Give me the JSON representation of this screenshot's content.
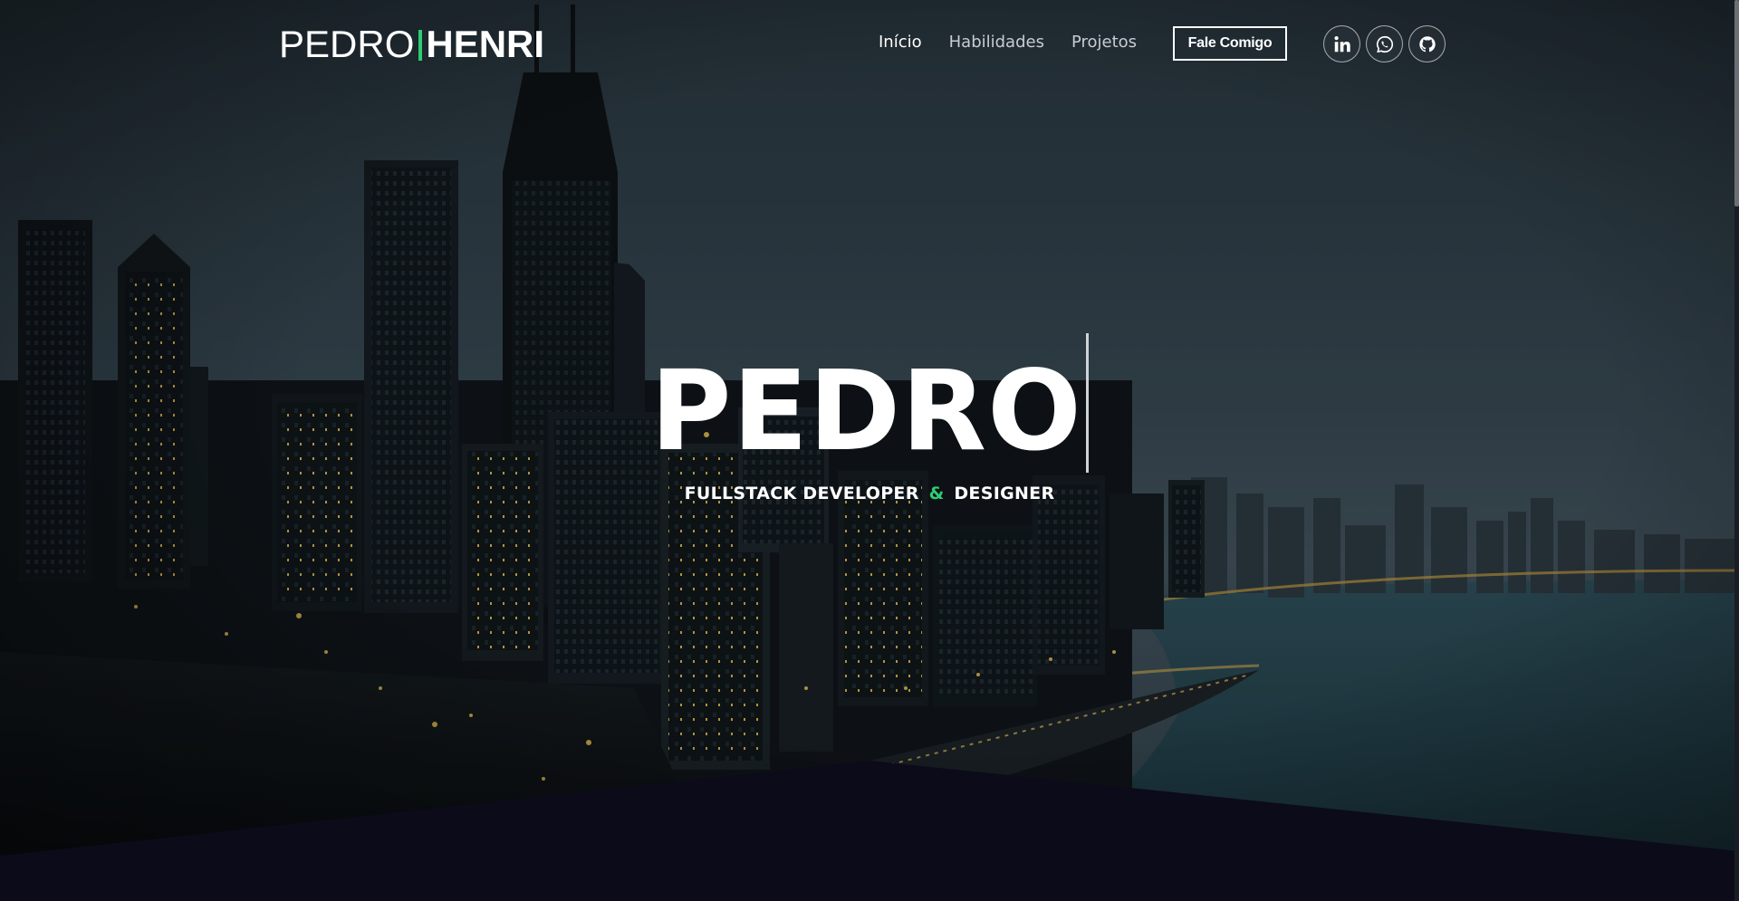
{
  "colors": {
    "accent": "#2ecc71",
    "sky_top": "#2b3b44",
    "sky_bottom": "#3a4a55",
    "water": "#1f3a45",
    "bottom_band": "#0c0b1a"
  },
  "header": {
    "logo_first": "PEDRO",
    "logo_second": "HENRI",
    "nav": [
      {
        "label": "Início",
        "active": true
      },
      {
        "label": "Habilidades",
        "active": false
      },
      {
        "label": "Projetos",
        "active": false
      }
    ],
    "cta_label": "Fale Comigo",
    "social": [
      {
        "icon": "linkedin-icon"
      },
      {
        "icon": "whatsapp-icon"
      },
      {
        "icon": "github-icon"
      }
    ]
  },
  "hero": {
    "title": "PEDRO",
    "subtitle_part1": "FULLSTACK DEVELOPER",
    "subtitle_amp": "&",
    "subtitle_part2": "DESIGNER"
  }
}
